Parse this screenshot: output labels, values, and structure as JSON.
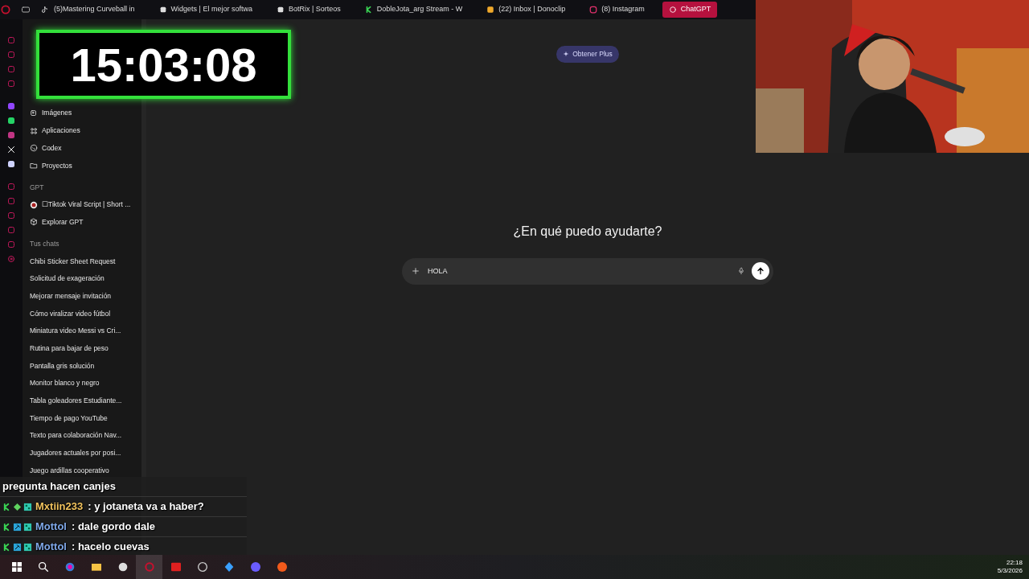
{
  "browser_tabs": [
    {
      "label": "(5)Mastering Curveball in",
      "selected": false
    },
    {
      "label": "Widgets | El mejor softwa",
      "selected": false
    },
    {
      "label": "BotRix | Sorteos",
      "selected": false
    },
    {
      "label": "DobleJota_arg Stream - W",
      "selected": false
    },
    {
      "label": "(22) Inbox | Donoclip",
      "selected": false
    },
    {
      "label": "(8) Instagram",
      "selected": false
    },
    {
      "label": "ChatGPT",
      "selected": true
    }
  ],
  "timer": "15:03:08",
  "sidebar": {
    "nav_items": [
      "Imágenes",
      "Aplicaciones",
      "Codex",
      "Proyectos"
    ],
    "gpt_heading": "GPT",
    "gpt_items": [
      "☐Tiktok Viral Script | Short ...",
      "Explorar GPT"
    ],
    "chats_heading": "Tus chats",
    "chats": [
      "Chibi Sticker Sheet Request",
      "Solicitud de exageración",
      "Mejorar mensaje invitación",
      "Cómo viralizar video fútbol",
      "Miniatura video Messi vs Cri...",
      "Rutina para bajar de peso",
      "Pantalla gris solución",
      "Monitor blanco y negro",
      "Tabla goleadores Estudiante...",
      "Tiempo de pago YouTube",
      "Texto para colaboración Nav...",
      "Jugadores actuales por posi...",
      "Juego ardillas cooperativo"
    ]
  },
  "main": {
    "upgrade_button": "Obtener Plus",
    "heading": "¿En qué puedo ayudarte?",
    "composer": {
      "value": "HOLA"
    }
  },
  "stream_chat": [
    {
      "text": "pregunta hacen canjes"
    },
    {
      "user": "Mxtiin233",
      "color": "#f2c35e",
      "text": ": y jotaneta va a haber?"
    },
    {
      "user": "Mottol",
      "color": "#7fa8e8",
      "text": ": dale gordo dale"
    },
    {
      "user": "Mottol",
      "color": "#7fa8e8",
      "text": ": hacelo cuevas"
    }
  ],
  "taskbar": {
    "time": "22:18",
    "date": "5/3/2026"
  }
}
